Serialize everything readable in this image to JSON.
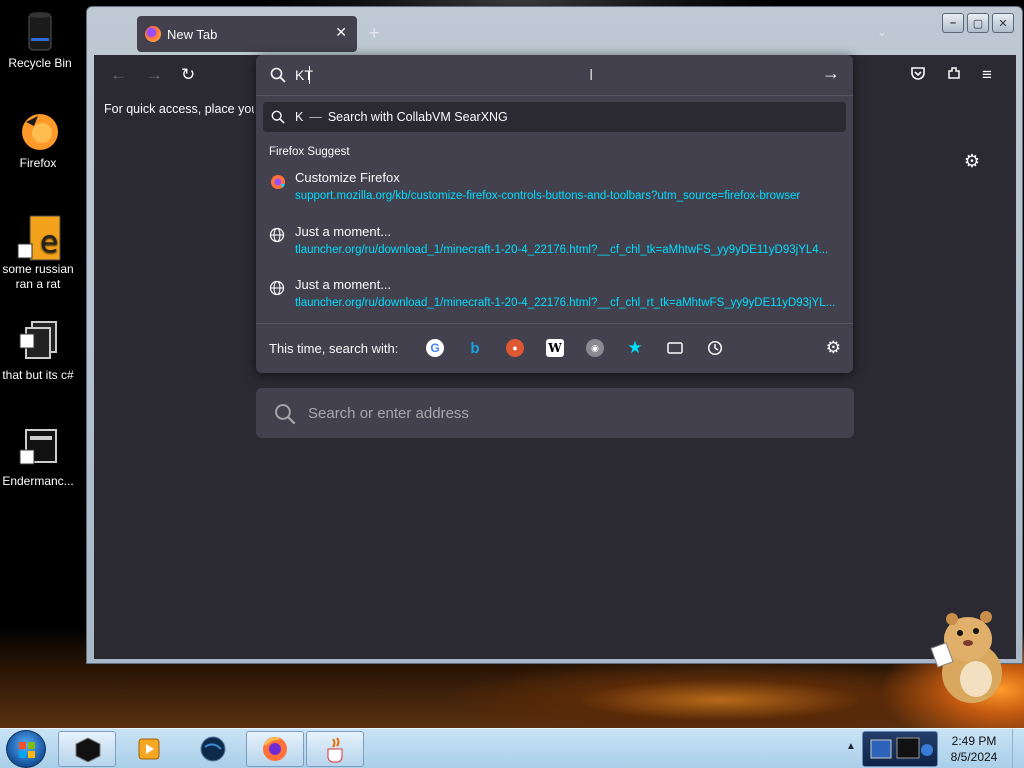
{
  "desktop": {
    "icons": [
      {
        "label": "Recycle Bin"
      },
      {
        "label": "Firefox"
      },
      {
        "label": "some russian ran a rat"
      },
      {
        "label": "that but its c#"
      },
      {
        "label": "Endermanc..."
      }
    ]
  },
  "browser": {
    "tab_title": "New Tab",
    "bookmark_hint": "For quick access, place your bookmarks here on the bookmarks toolbar.",
    "urlbar": {
      "value": "KT",
      "search_row": {
        "query": "K",
        "separator": "—",
        "action": "Search with CollabVM SearXNG"
      },
      "section_heading": "Firefox Suggest",
      "suggestions": [
        {
          "title": "Customize Firefox",
          "url": "support.mozilla.org/kb/customize-firefox-controls-buttons-and-toolbars?utm_source=firefox-browser",
          "icon": "firefox-icon"
        },
        {
          "title": "Just a moment...",
          "url": "tlauncher.org/ru/download_1/minecraft-1-20-4_22176.html?__cf_chl_tk=aMhtwFS_yy9yDE11yD93jYL4...",
          "icon": "globe-icon"
        },
        {
          "title": "Just a moment...",
          "url": "tlauncher.org/ru/download_1/minecraft-1-20-4_22176.html?__cf_chl_rt_tk=aMhtwFS_yy9yDE11yD93jYL...",
          "icon": "globe-icon"
        }
      ],
      "one_off_label": "This time, search with:",
      "engines": [
        "google-icon",
        "bing-icon",
        "duckduckgo-icon",
        "wikipedia-icon",
        "searxng-icon",
        "bookmarks-icon",
        "tabs-icon",
        "history-icon"
      ]
    },
    "page_search_placeholder": "Search or enter address"
  },
  "taskbar": {
    "time": "2:49 PM",
    "date": "8/5/2024"
  },
  "colors": {
    "browser_bg": "#2b2a33",
    "panel_bg": "#42414d",
    "link": "#00ddff",
    "taskbar": "#b9d9ef"
  }
}
